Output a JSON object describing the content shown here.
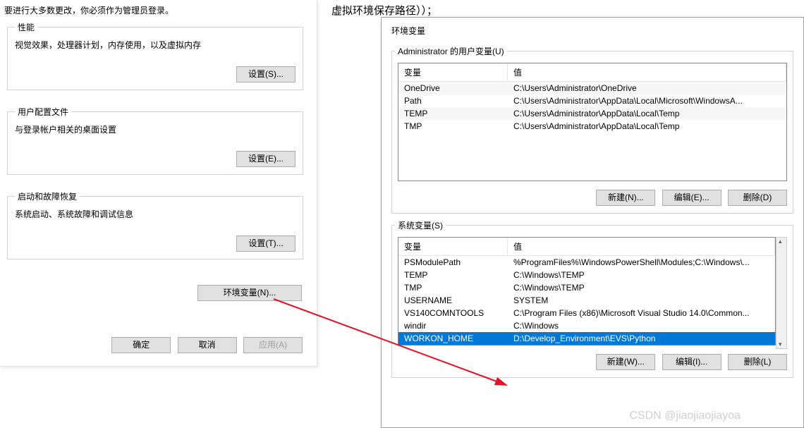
{
  "left": {
    "top_line": "要进行大多数更改，你必须作为管理员登录。",
    "perf": {
      "legend": "性能",
      "desc": "视觉效果，处理器计划，内存使用，以及虚拟内存",
      "btn": "设置(S)..."
    },
    "user": {
      "legend": "用户配置文件",
      "desc": "与登录帐户相关的桌面设置",
      "btn": "设置(E)..."
    },
    "boot": {
      "legend": "启动和故障恢复",
      "desc": "系统启动、系统故障和调试信息",
      "btn": "设置(T)..."
    },
    "env_btn": "环境变量(N)...",
    "footer": {
      "ok": "确定",
      "cancel": "取消",
      "apply": "应用(A)"
    }
  },
  "code_line": "虚拟环境保存路径））；",
  "env": {
    "title": "环境变量",
    "user_legend": "Administrator 的用户变量(U)",
    "sys_legend": "系统变量(S)",
    "headers": {
      "var": "变量",
      "val": "值"
    },
    "user_rows": [
      {
        "var": "OneDrive",
        "val": "C:\\Users\\Administrator\\OneDrive"
      },
      {
        "var": "Path",
        "val": "C:\\Users\\Administrator\\AppData\\Local\\Microsoft\\WindowsA..."
      },
      {
        "var": "TEMP",
        "val": "C:\\Users\\Administrator\\AppData\\Local\\Temp"
      },
      {
        "var": "TMP",
        "val": "C:\\Users\\Administrator\\AppData\\Local\\Temp"
      }
    ],
    "sys_rows": [
      {
        "var": "PSModulePath",
        "val": "%ProgramFiles%\\WindowsPowerShell\\Modules;C:\\Windows\\..."
      },
      {
        "var": "TEMP",
        "val": "C:\\Windows\\TEMP"
      },
      {
        "var": "TMP",
        "val": "C:\\Windows\\TEMP"
      },
      {
        "var": "USERNAME",
        "val": "SYSTEM"
      },
      {
        "var": "VS140COMNTOOLS",
        "val": "C:\\Program Files (x86)\\Microsoft Visual Studio 14.0\\Common..."
      },
      {
        "var": "windir",
        "val": "C:\\Windows"
      },
      {
        "var": "WORKON_HOME",
        "val": "D:\\Develop_Environment\\EVS\\Python",
        "selected": true
      }
    ],
    "buttons": {
      "new_u": "新建(N)...",
      "edit_u": "编辑(E)...",
      "del_u": "删除(D)",
      "new_s": "新建(W)...",
      "edit_s": "编辑(I)...",
      "del_s": "删除(L)"
    }
  },
  "watermark": "CSDN @jiaojiaojiayoa"
}
